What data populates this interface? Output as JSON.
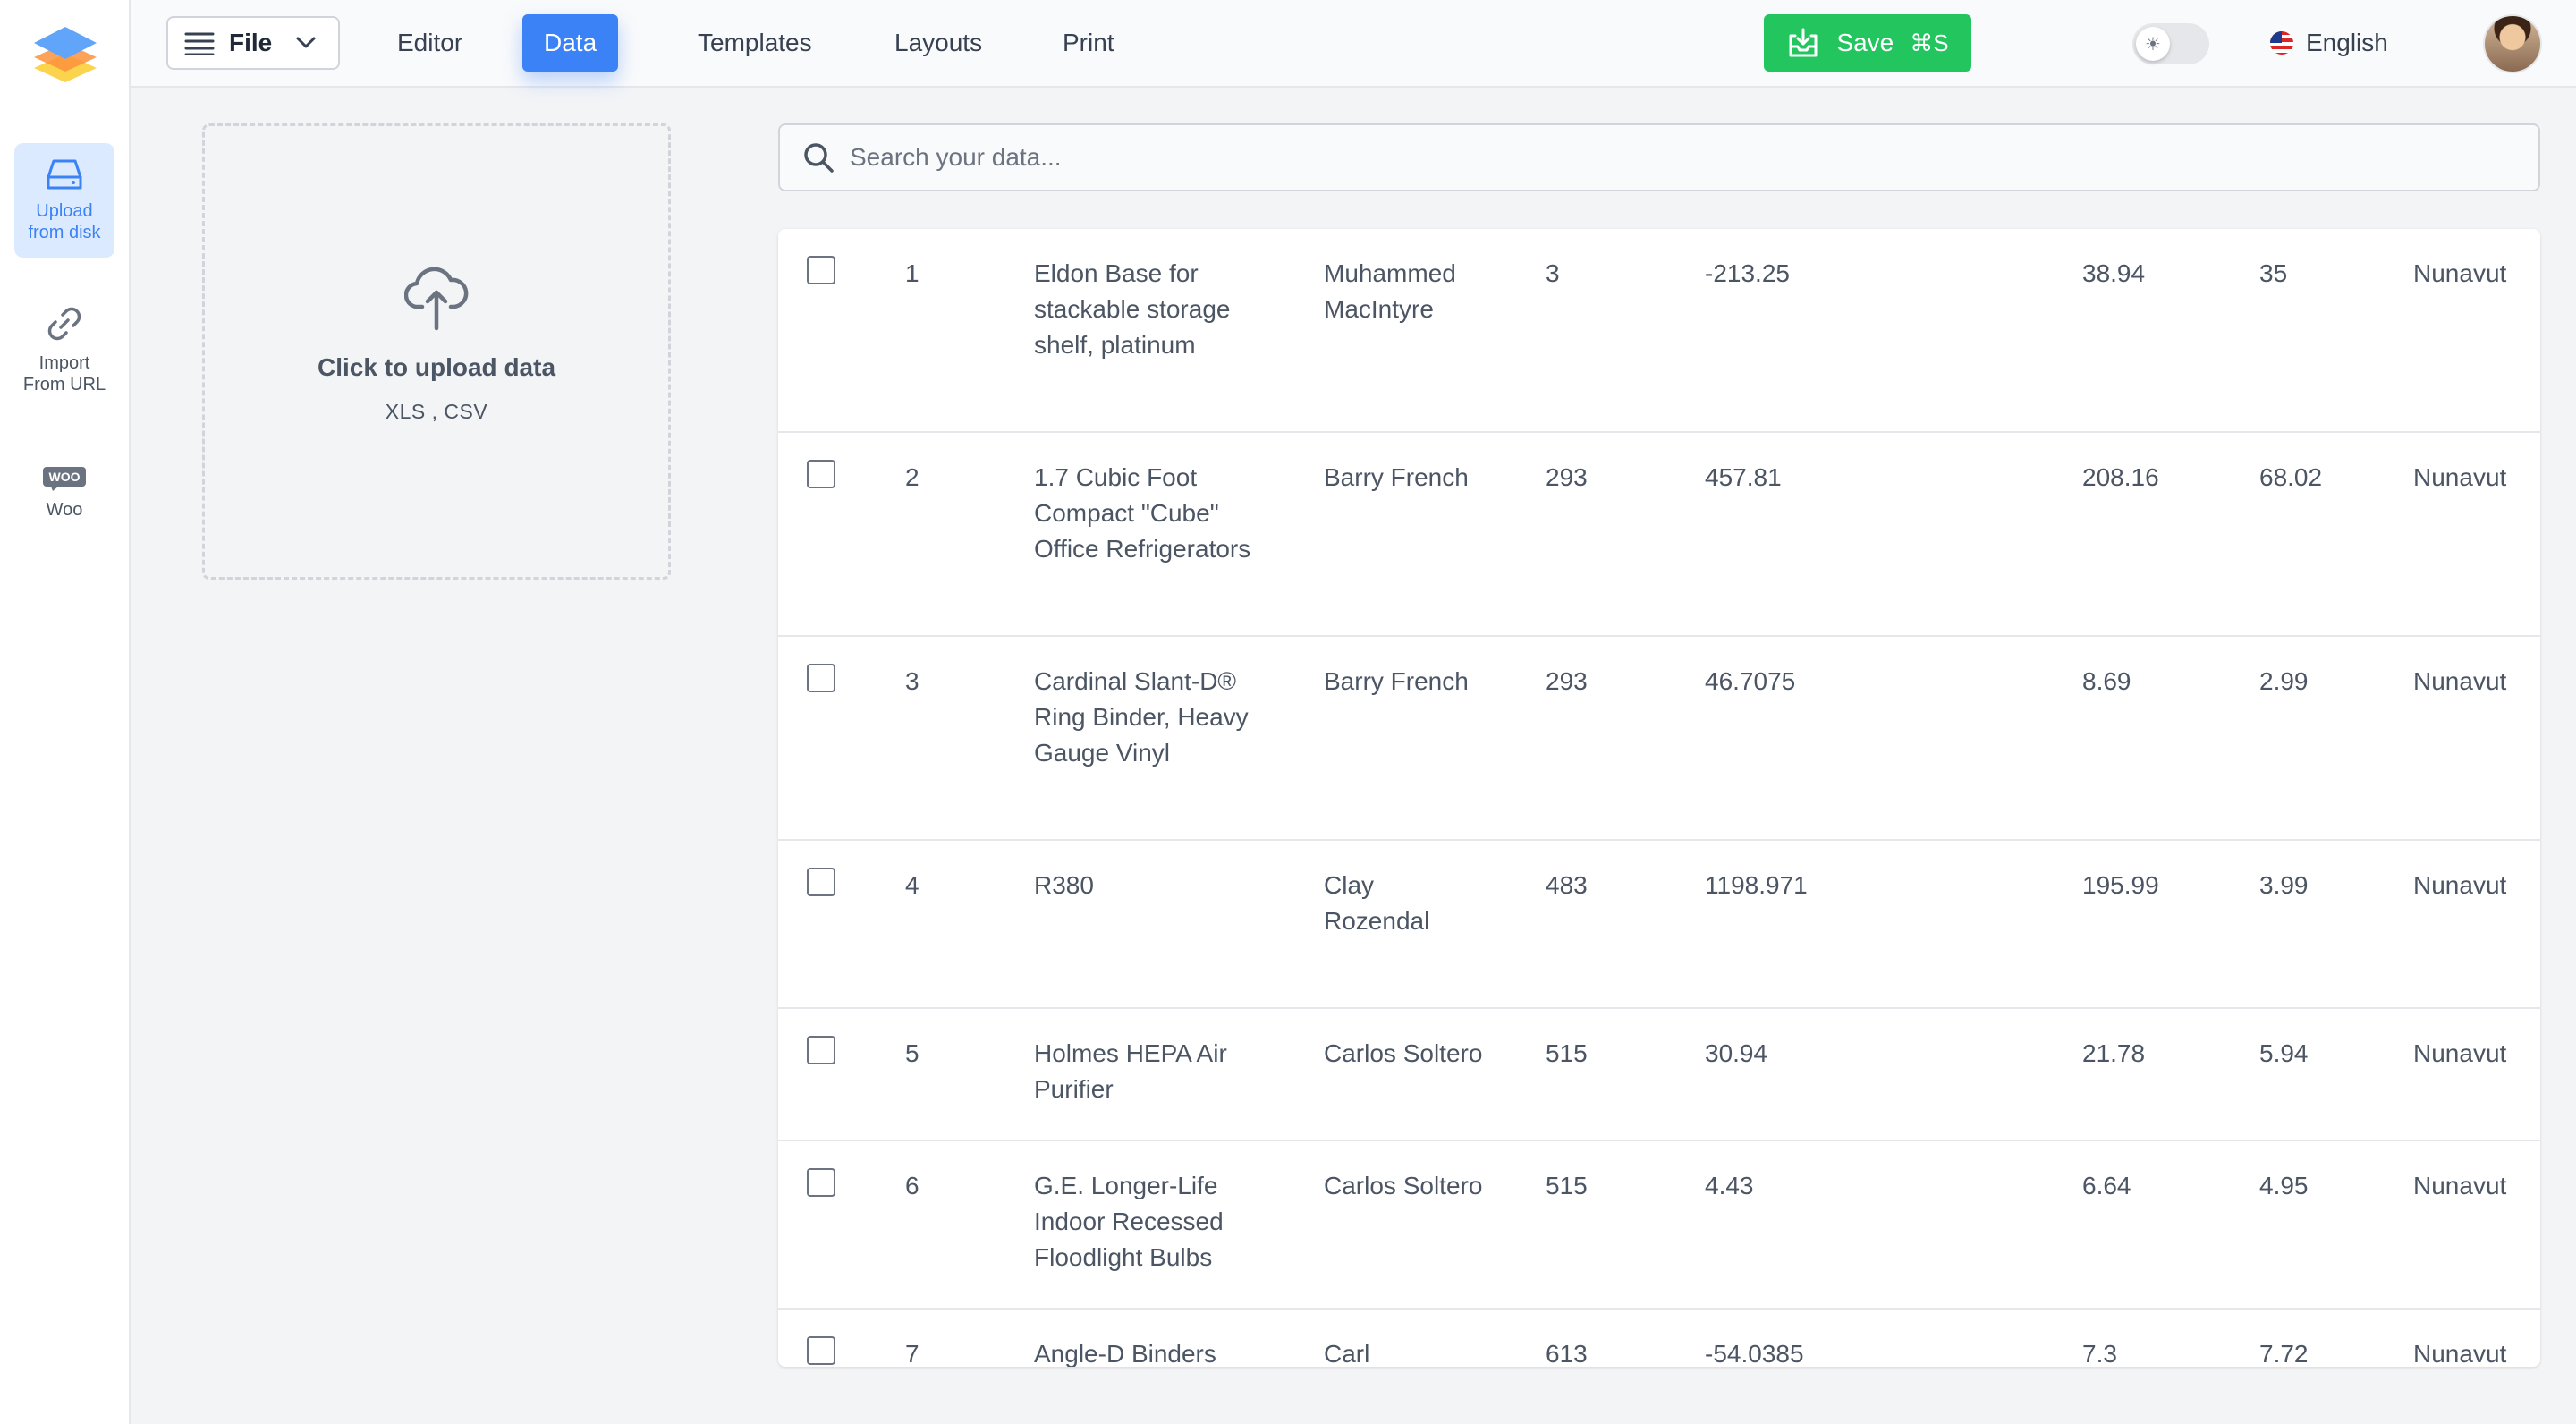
{
  "rail": {
    "items": [
      {
        "label": "Upload from disk",
        "label_line1": "Upload",
        "label_line2": "from disk",
        "icon": "hard-drive-icon",
        "active": true
      },
      {
        "label": "Import From URL",
        "label_line1": "Import",
        "label_line2": "From URL",
        "icon": "link-icon",
        "active": false
      },
      {
        "label": "Woo",
        "label_line1": "Woo",
        "label_line2": "",
        "icon": "woo-icon",
        "active": false
      }
    ]
  },
  "topbar": {
    "file_label": "File",
    "nav": [
      {
        "label": "Editor",
        "active": false
      },
      {
        "label": "Data",
        "active": true
      },
      {
        "label": "Templates",
        "active": false
      },
      {
        "label": "Layouts",
        "active": false
      },
      {
        "label": "Print",
        "active": false
      }
    ],
    "save_label": "Save",
    "save_shortcut": "⌘S",
    "language": "English"
  },
  "upload": {
    "title": "Click to upload data",
    "formats": "XLS , CSV"
  },
  "search": {
    "placeholder": "Search your data...",
    "value": ""
  },
  "table": {
    "rows": [
      {
        "id": "1",
        "product": "Eldon Base for stackable storage shelf, platinum",
        "customer": "Muhammed MacIntyre",
        "qty": "3",
        "sales": "-213.25",
        "price": "38.94",
        "shipping": "35",
        "province": "Nunavut"
      },
      {
        "id": "2",
        "product": "1.7 Cubic Foot Compact \"Cube\" Office Refrigerators",
        "customer": "Barry French",
        "qty": "293",
        "sales": "457.81",
        "price": "208.16",
        "shipping": "68.02",
        "province": "Nunavut"
      },
      {
        "id": "3",
        "product": "Cardinal Slant-D® Ring Binder, Heavy Gauge Vinyl",
        "customer": "Barry French",
        "qty": "293",
        "sales": "46.7075",
        "price": "8.69",
        "shipping": "2.99",
        "province": "Nunavut"
      },
      {
        "id": "4",
        "product": "R380",
        "customer": "Clay Rozendal",
        "qty": "483",
        "sales": "1198.971",
        "price": "195.99",
        "shipping": "3.99",
        "province": "Nunavut"
      },
      {
        "id": "5",
        "product": "Holmes HEPA Air Purifier",
        "customer": "Carlos Soltero",
        "qty": "515",
        "sales": "30.94",
        "price": "21.78",
        "shipping": "5.94",
        "province": "Nunavut"
      },
      {
        "id": "6",
        "product": "G.E. Longer-Life Indoor Recessed Floodlight Bulbs",
        "customer": "Carlos Soltero",
        "qty": "515",
        "sales": "4.43",
        "price": "6.64",
        "shipping": "4.95",
        "province": "Nunavut"
      },
      {
        "id": "7",
        "product": "Angle-D Binders",
        "customer": "Carl",
        "qty": "613",
        "sales": "-54.0385",
        "price": "7.3",
        "shipping": "7.72",
        "province": "Nunavut"
      }
    ]
  },
  "colors": {
    "accent": "#3b82f6",
    "save": "#22c55e",
    "background": "#f3f4f6"
  }
}
